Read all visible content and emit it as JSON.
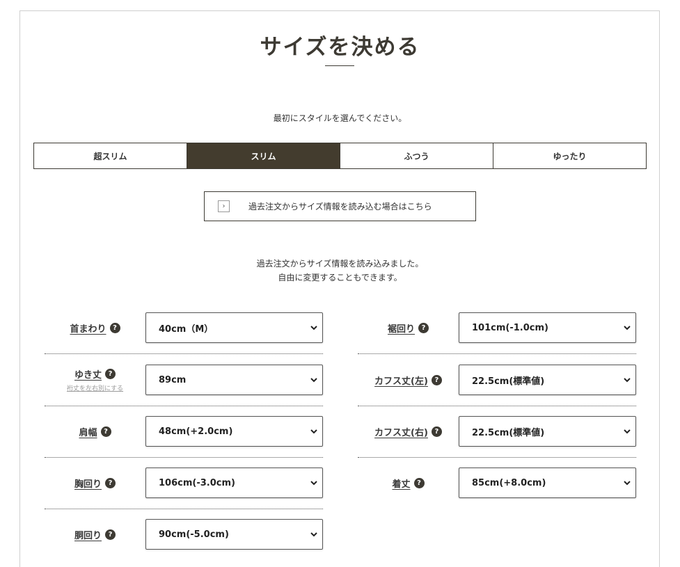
{
  "page": {
    "title": "サイズを決める",
    "instruction": "最初にスタイルを選んでください。",
    "styles": [
      "超スリム",
      "スリム",
      "ふつう",
      "ゆったり"
    ],
    "active_style": "スリム",
    "load_button": {
      "arrow": "›",
      "label": "過去注文からサイズ情報を読み込む場合はこちら"
    },
    "notice_line1": "過去注文からサイズ情報を読み込みました。",
    "notice_line2": "自由に変更することもできます。"
  },
  "fields": {
    "neck": {
      "label": "首まわり",
      "value": "40cm（M）"
    },
    "sleeve": {
      "label": "ゆき丈",
      "sublink": "裄丈を左右別にする",
      "value": "89cm"
    },
    "shoulder": {
      "label": "肩幅",
      "value": "48cm(+2.0cm)"
    },
    "chest": {
      "label": "胸回り",
      "value": "106cm(-3.0cm)"
    },
    "waist": {
      "label": "胴回り",
      "value": "90cm(-5.0cm)"
    },
    "hem": {
      "label": "裾回り",
      "value": "101cm(-1.0cm)"
    },
    "cuff_left": {
      "label": "カフス丈(左)",
      "value": "22.5cm(標準値)"
    },
    "cuff_right": {
      "label": "カフス丈(右)",
      "value": "22.5cm(標準値)"
    },
    "length": {
      "label": "着丈",
      "value": "85cm(+8.0cm)"
    }
  },
  "icons": {
    "help": "?",
    "help_icon_name": "question-circle-icon",
    "select_icon_name": "chevron-down-icon"
  },
  "colors": {
    "accent": "#433c2e",
    "border": "#3d3a33"
  }
}
